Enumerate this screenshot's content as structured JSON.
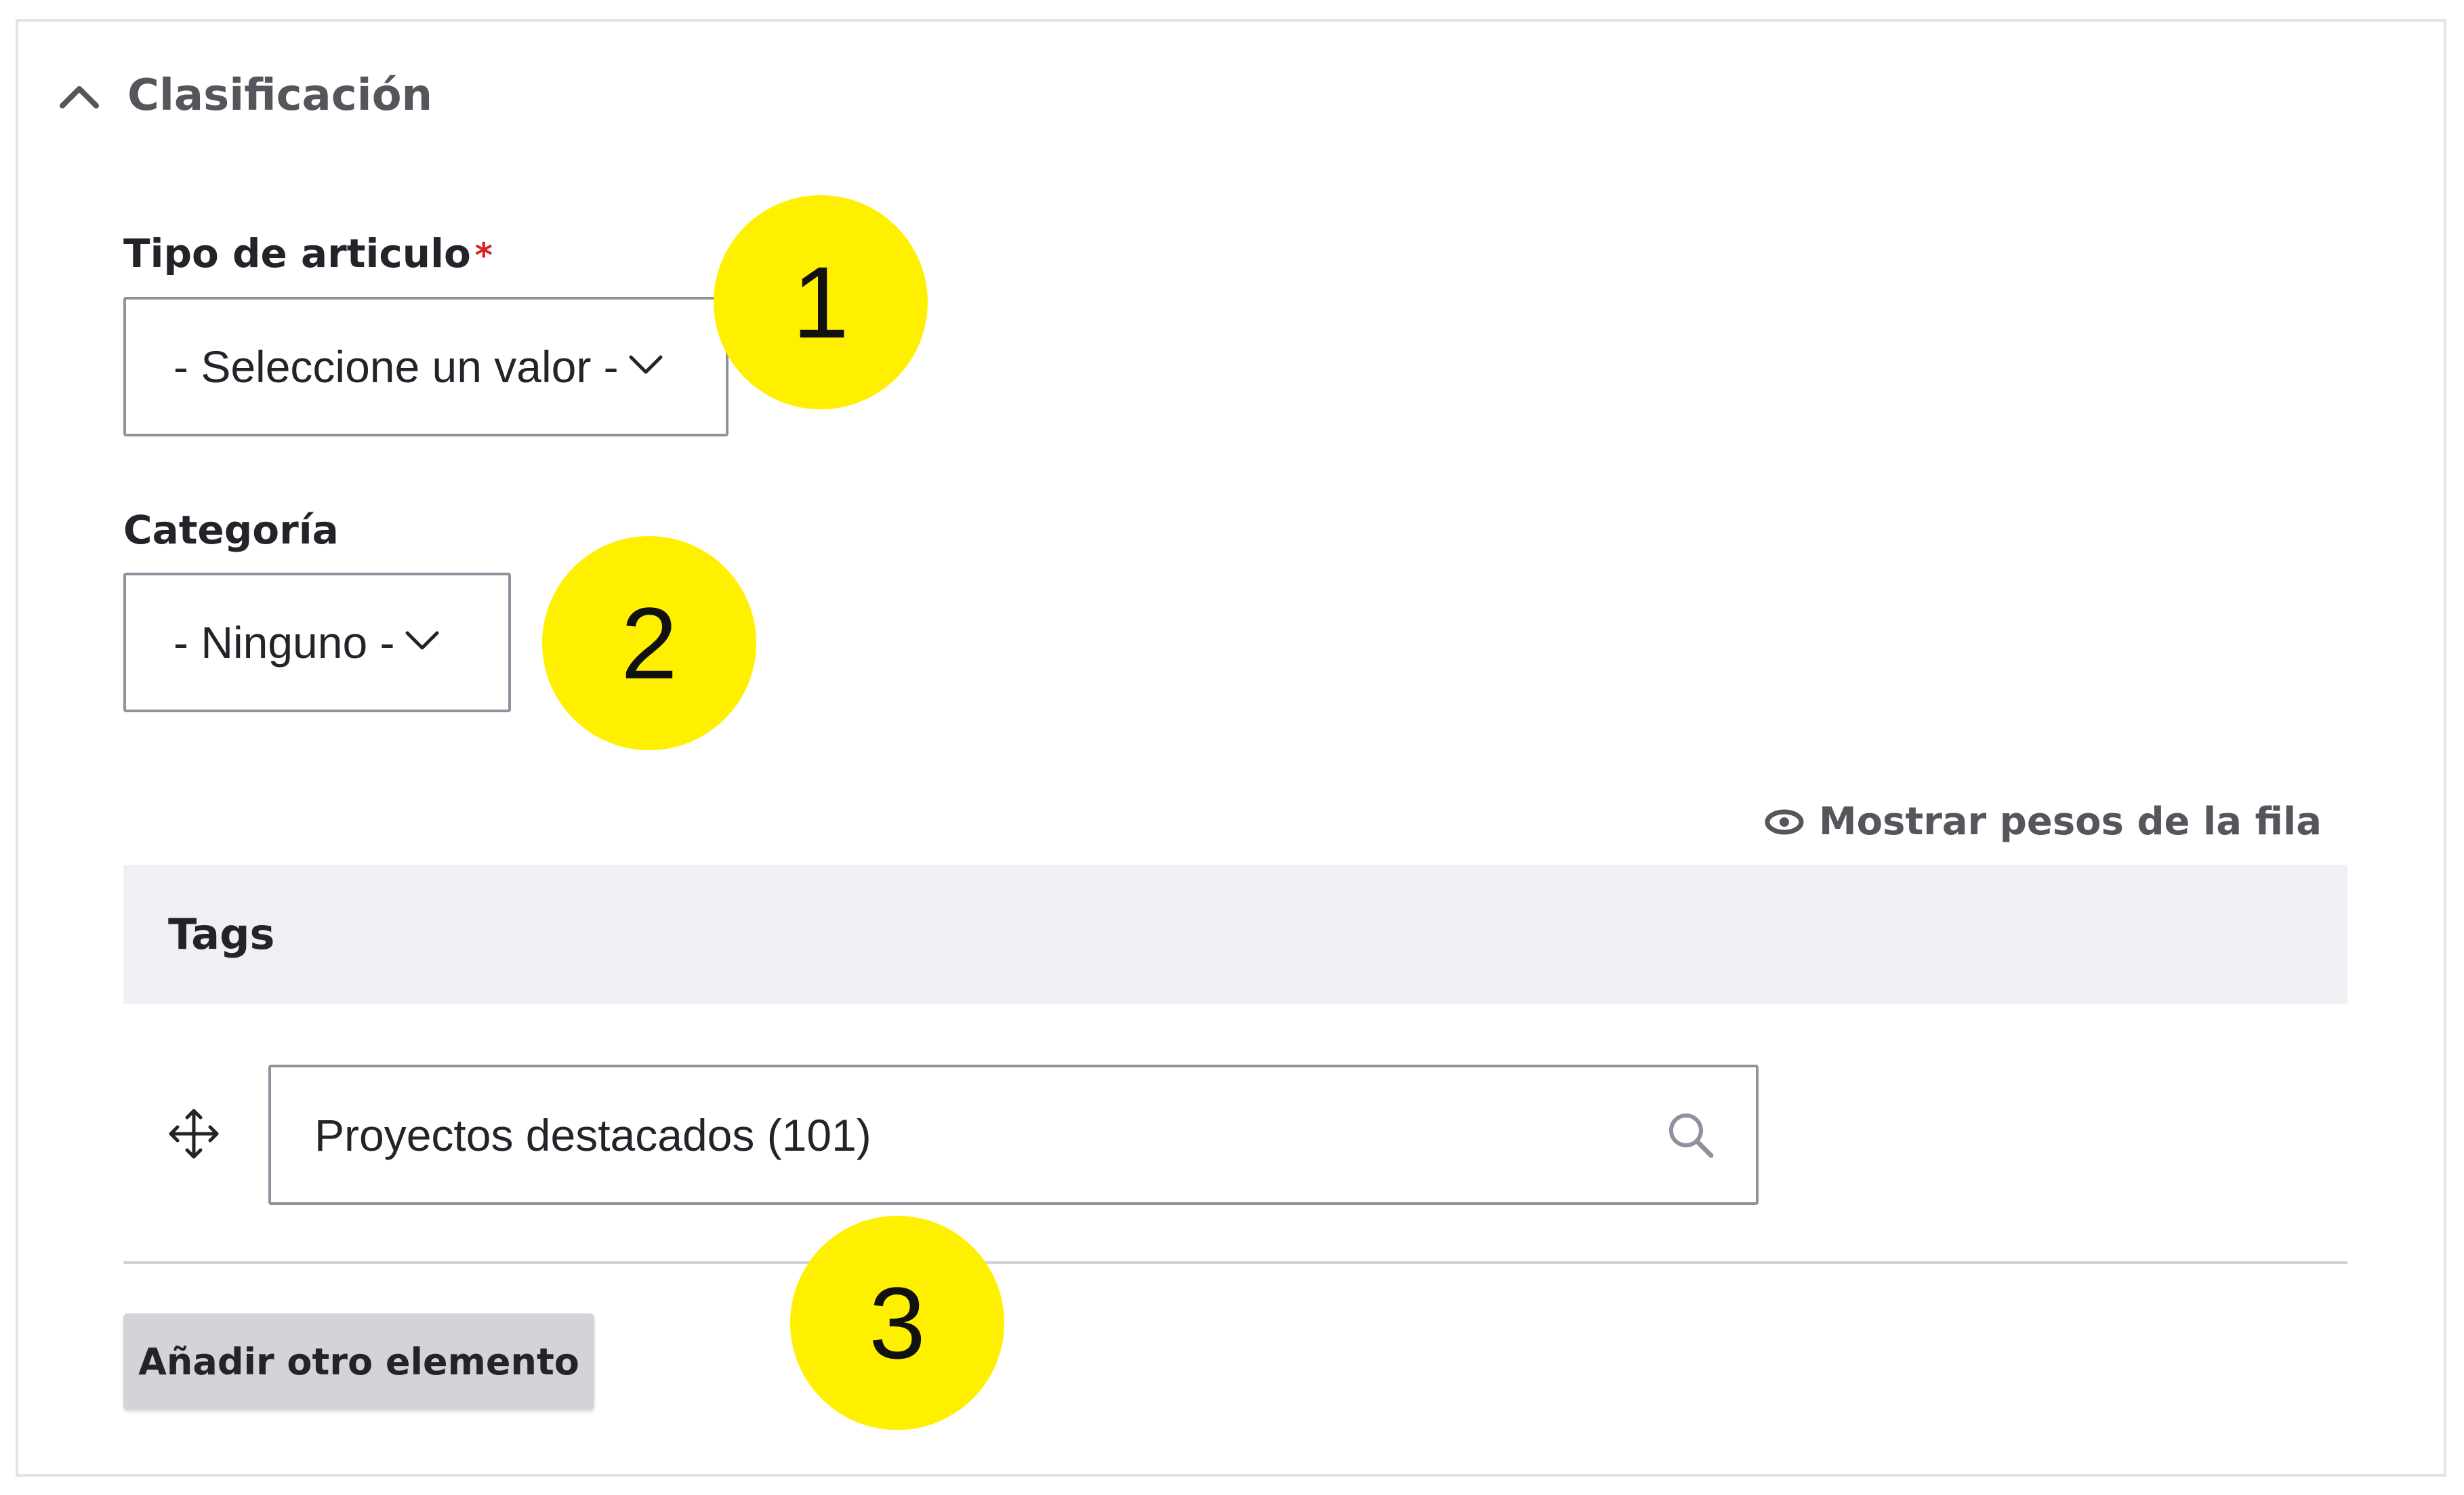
{
  "section": {
    "title": "Clasificación"
  },
  "fields": {
    "tipo_articulo": {
      "label": "Tipo de articulo",
      "required_mark": "*",
      "value": "- Seleccione un valor -"
    },
    "categoria": {
      "label": "Categoría",
      "value": "- Ninguno -"
    }
  },
  "tags_table": {
    "show_weights_label": "Mostrar pesos de la fila",
    "header": "Tags",
    "rows": [
      {
        "value": "Proyectos destacados (101)"
      }
    ],
    "add_button_label": "Añadir otro elemento"
  },
  "callouts": [
    "1",
    "2",
    "3"
  ],
  "colors": {
    "callout": "#fff000",
    "required": "#d72222",
    "table_header_bg": "#eff0f4",
    "button_bg": "#d3d4d9"
  },
  "icons": [
    "chevron-up-icon",
    "chevron-down-icon",
    "eye-icon",
    "move-icon",
    "search-icon"
  ]
}
